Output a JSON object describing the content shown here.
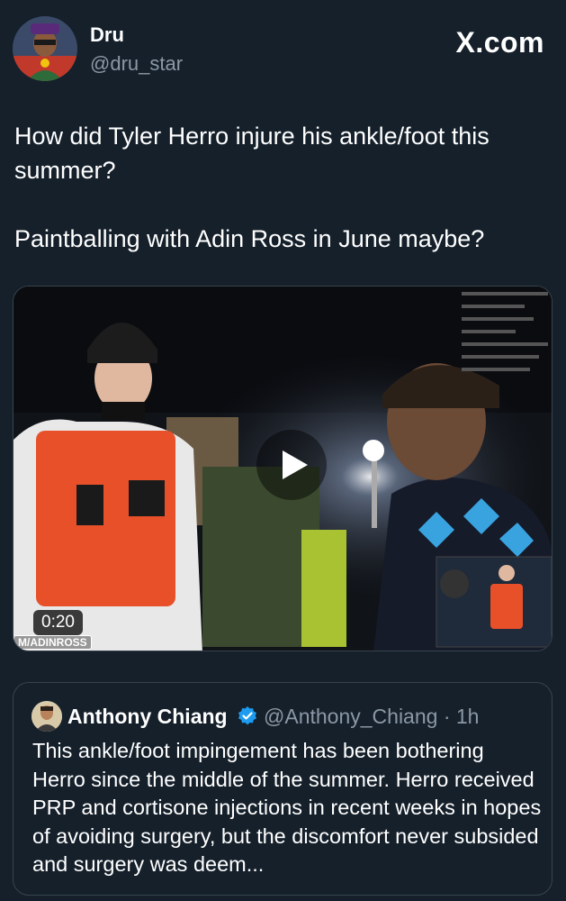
{
  "author": {
    "display_name": "Dru",
    "handle": "@dru_star"
  },
  "site": {
    "logo_text": "X.com"
  },
  "tweet": {
    "text": "How did Tyler Herro injure his ankle/foot this summer?\n\nPaintballing with Adin Ross in June maybe?"
  },
  "video": {
    "duration": "0:20",
    "watermark": "M/ADINROSS",
    "play_icon": "play-icon"
  },
  "quote": {
    "display_name": "Anthony Chiang",
    "verified_icon": "verified-badge-icon",
    "verified_color": "#1d9bf0",
    "handle_time": "@Anthony_Chiang · 1h",
    "text": "This ankle/foot impingement has been bothering Herro since the middle of the summer. Herro received PRP and cortisone injections in recent weeks in hopes of avoiding surgery, but the discomfort never subsided and surgery was deem..."
  },
  "colors": {
    "background": "#15202b",
    "border": "#38444d",
    "secondary_text": "#8b98a5"
  }
}
